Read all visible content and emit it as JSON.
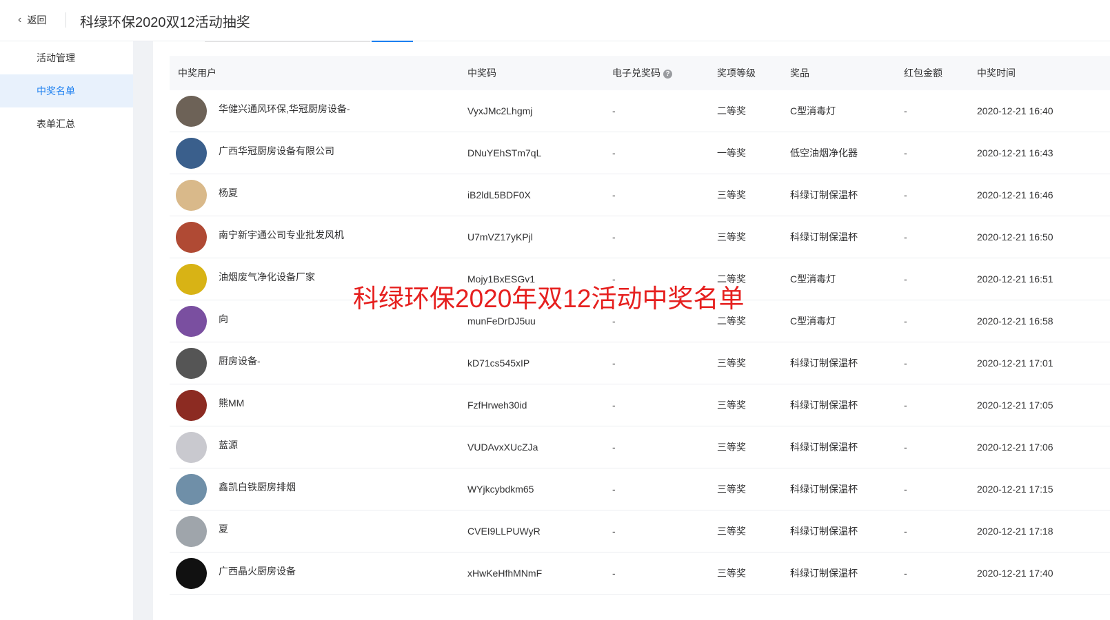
{
  "header": {
    "back_label": "返回",
    "title": "科绿环保2020双12活动抽奖"
  },
  "sidebar": {
    "items": [
      {
        "label": "活动管理"
      },
      {
        "label": "中奖名单"
      },
      {
        "label": "表单汇总"
      }
    ]
  },
  "table": {
    "columns": [
      "中奖用户",
      "中奖码",
      "电子兑奖码",
      "奖项等级",
      "奖品",
      "红包金额",
      "中奖时间"
    ],
    "rows": [
      {
        "user": "华健兴通风环保,华冠厨房设备-",
        "code": "VyxJMc2Lhgmj",
        "voucher": "-",
        "level": "二等奖",
        "prize": "C型消毒灯",
        "redpacket": "-",
        "time": "2020-12-21 16:40",
        "avatar_color": "#6d6257"
      },
      {
        "user": "广西华冠厨房设备有限公司",
        "code": "DNuYEhSTm7qL",
        "voucher": "-",
        "level": "一等奖",
        "prize": "低空油烟净化器",
        "redpacket": "-",
        "time": "2020-12-21 16:43",
        "avatar_color": "#3a5f8c"
      },
      {
        "user": "杨夏",
        "code": "iB2ldL5BDF0X",
        "voucher": "-",
        "level": "三等奖",
        "prize": "科绿订制保温杯",
        "redpacket": "-",
        "time": "2020-12-21 16:46",
        "avatar_color": "#d9b98a"
      },
      {
        "user": "南宁新宇通公司专业批发风机",
        "code": "U7mVZ17yKPjl",
        "voucher": "-",
        "level": "三等奖",
        "prize": "科绿订制保温杯",
        "redpacket": "-",
        "time": "2020-12-21 16:50",
        "avatar_color": "#b04a34"
      },
      {
        "user": "油烟废气净化设备厂家",
        "code": "Mojy1BxESGv1",
        "voucher": "-",
        "level": "二等奖",
        "prize": "C型消毒灯",
        "redpacket": "-",
        "time": "2020-12-21 16:51",
        "avatar_color": "#d8b315"
      },
      {
        "user": "向",
        "code": "munFeDrDJ5uu",
        "voucher": "-",
        "level": "二等奖",
        "prize": "C型消毒灯",
        "redpacket": "-",
        "time": "2020-12-21 16:58",
        "avatar_color": "#7a4fa0"
      },
      {
        "user": "厨房设备-",
        "code": "kD71cs545xIP",
        "voucher": "-",
        "level": "三等奖",
        "prize": "科绿订制保温杯",
        "redpacket": "-",
        "time": "2020-12-21 17:01",
        "avatar_color": "#555555"
      },
      {
        "user": "熊MM",
        "code": "FzfHrweh30id",
        "voucher": "-",
        "level": "三等奖",
        "prize": "科绿订制保温杯",
        "redpacket": "-",
        "time": "2020-12-21 17:05",
        "avatar_color": "#8c2b22"
      },
      {
        "user": "蓝源",
        "code": "VUDAvxXUcZJa",
        "voucher": "-",
        "level": "三等奖",
        "prize": "科绿订制保温杯",
        "redpacket": "-",
        "time": "2020-12-21 17:06",
        "avatar_color": "#c9c9cf"
      },
      {
        "user": "鑫凯白铁厨房排烟",
        "code": "WYjkcybdkm65",
        "voucher": "-",
        "level": "三等奖",
        "prize": "科绿订制保温杯",
        "redpacket": "-",
        "time": "2020-12-21 17:15",
        "avatar_color": "#6f8fa8"
      },
      {
        "user": "夏",
        "code": "CVEI9LLPUWyR",
        "voucher": "-",
        "level": "三等奖",
        "prize": "科绿订制保温杯",
        "redpacket": "-",
        "time": "2020-12-21 17:18",
        "avatar_color": "#9fa5ab"
      },
      {
        "user": "广西晶火厨房设备",
        "code": "xHwKeHfhMNmF",
        "voucher": "-",
        "level": "三等奖",
        "prize": "科绿订制保温杯",
        "redpacket": "-",
        "time": "2020-12-21 17:40",
        "avatar_color": "#111111"
      }
    ]
  },
  "overlay": {
    "text": "科绿环保2020年双12活动中奖名单",
    "color": "#e6201f"
  },
  "colors": {
    "accent": "#1b7ff0",
    "sidebar_active_bg": "#e8f1fc"
  }
}
